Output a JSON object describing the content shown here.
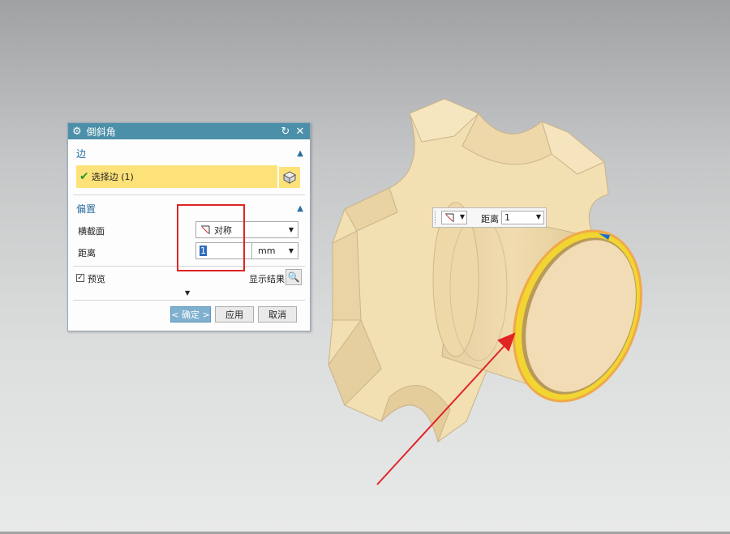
{
  "dialog": {
    "title": "倒斜角",
    "reset_icon": "reset-icon",
    "close_icon": "close-icon",
    "edge_section": {
      "label": "边",
      "select_edge_label": "选择边 (1)"
    },
    "offset_section": {
      "label": "偏置",
      "cross_section_label": "横截面",
      "cross_section_value": "对称",
      "distance_label": "距离",
      "distance_value": "1",
      "distance_unit": "mm"
    },
    "preview_label": "预览",
    "show_result_label": "显示结果",
    "buttons": {
      "ok": "< 确定 >",
      "apply": "应用",
      "cancel": "取消"
    }
  },
  "float_toolbar": {
    "distance_label": "距离",
    "distance_value": "1"
  },
  "colors": {
    "titlebar": "#4b8fa8",
    "selection_highlight": "#fde27a",
    "annotation_red": "#e02424",
    "model_face": "#f3ddaa"
  }
}
